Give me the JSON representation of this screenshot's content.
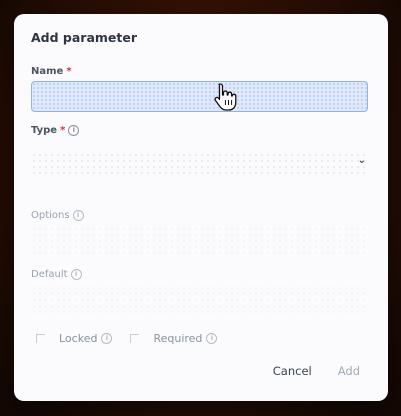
{
  "dialog": {
    "title": "Add parameter",
    "name_label": "Name",
    "name_required_mark": "*",
    "name_value": "",
    "type_label": "Type",
    "type_required_mark": "*",
    "type_value": "",
    "options_label": "Options",
    "default_label": "Default",
    "locked_label": "Locked",
    "required_label": "Required",
    "cancel_label": "Cancel",
    "add_label": "Add"
  }
}
